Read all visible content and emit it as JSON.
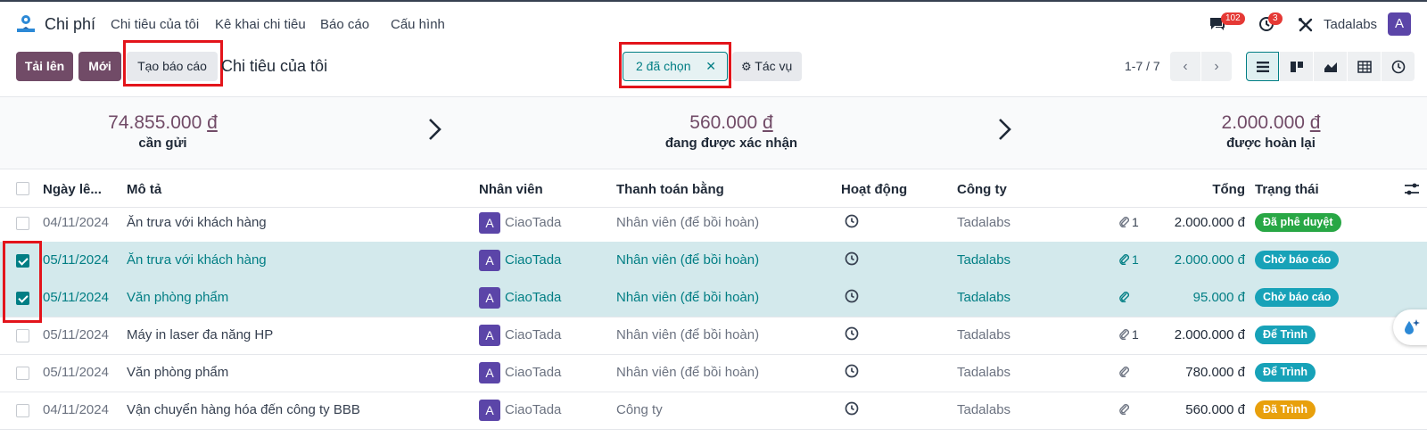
{
  "nav": {
    "app_title": "Chi phí",
    "menu": [
      "Chi tiêu của tôi",
      "Kê khai chi tiêu",
      "Báo cáo",
      "Cấu hình"
    ],
    "messages_count": "102",
    "activities_count": "3",
    "company": "Tadalabs",
    "user_initial": "A"
  },
  "control": {
    "upload_label": "Tải lên",
    "new_label": "Mới",
    "create_report_label": "Tạo báo cáo",
    "breadcrumb": "Chi tiêu của tôi",
    "selected_label": "2 đã chọn",
    "selected_clear": "✕",
    "actions_label": "Tác vụ",
    "pager": "1-7 / 7"
  },
  "stats": [
    {
      "amount": "74.855.000",
      "currency": "đ",
      "label": "cần gửi"
    },
    {
      "amount": "560.000",
      "currency": "đ",
      "label": "đang được xác nhận"
    },
    {
      "amount": "2.000.000",
      "currency": "đ",
      "label": "được hoàn lại"
    }
  ],
  "table": {
    "headers": {
      "date": "Ngày lê...",
      "description": "Mô tả",
      "employee": "Nhân viên",
      "paid_by": "Thanh toán bằng",
      "activity": "Hoạt động",
      "company": "Công ty",
      "total": "Tổng",
      "status": "Trạng thái"
    },
    "rows": [
      {
        "date": "04/11/2024",
        "description": "Ăn trưa với khách hàng",
        "employee_initial": "A",
        "employee": "CiaoTada",
        "paid_by": "Nhân viên (để bồi hoàn)",
        "company": "Tadalabs",
        "attachments": "1",
        "total": "2.000.000 đ",
        "status": "Đã phê duyệt",
        "status_color": "#28a745",
        "selected": false
      },
      {
        "date": "05/11/2024",
        "description": "Ăn trưa với khách hàng",
        "employee_initial": "A",
        "employee": "CiaoTada",
        "paid_by": "Nhân viên (để bồi hoàn)",
        "company": "Tadalabs",
        "attachments": "1",
        "total": "2.000.000 đ",
        "status": "Chờ báo cáo",
        "status_color": "#17a2b8",
        "selected": true
      },
      {
        "date": "05/11/2024",
        "description": "Văn phòng phẩm",
        "employee_initial": "A",
        "employee": "CiaoTada",
        "paid_by": "Nhân viên (để bồi hoàn)",
        "company": "Tadalabs",
        "attachments": "",
        "total": "95.000 đ",
        "status": "Chờ báo cáo",
        "status_color": "#17a2b8",
        "selected": true
      },
      {
        "date": "05/11/2024",
        "description": "Máy in laser đa năng HP",
        "employee_initial": "A",
        "employee": "CiaoTada",
        "paid_by": "Nhân viên (để bồi hoàn)",
        "company": "Tadalabs",
        "attachments": "1",
        "total": "2.000.000 đ",
        "status": "Để Trình",
        "status_color": "#17a2b8",
        "selected": false
      },
      {
        "date": "05/11/2024",
        "description": "Văn phòng phẩm",
        "employee_initial": "A",
        "employee": "CiaoTada",
        "paid_by": "Nhân viên (để bồi hoàn)",
        "company": "Tadalabs",
        "attachments": "",
        "total": "780.000 đ",
        "status": "Để Trình",
        "status_color": "#17a2b8",
        "selected": false
      },
      {
        "date": "04/11/2024",
        "description": "Vận chuyển hàng hóa đến công ty BBB",
        "employee_initial": "A",
        "employee": "CiaoTada",
        "paid_by": "Công ty",
        "company": "Tadalabs",
        "attachments": "",
        "total": "560.000 đ",
        "status": "Đã Trình",
        "status_color": "#e8a00c",
        "selected": false
      }
    ]
  },
  "colors": {
    "brand": "#714b67",
    "accent": "#017e84",
    "highlight_box": "#e3141b"
  }
}
